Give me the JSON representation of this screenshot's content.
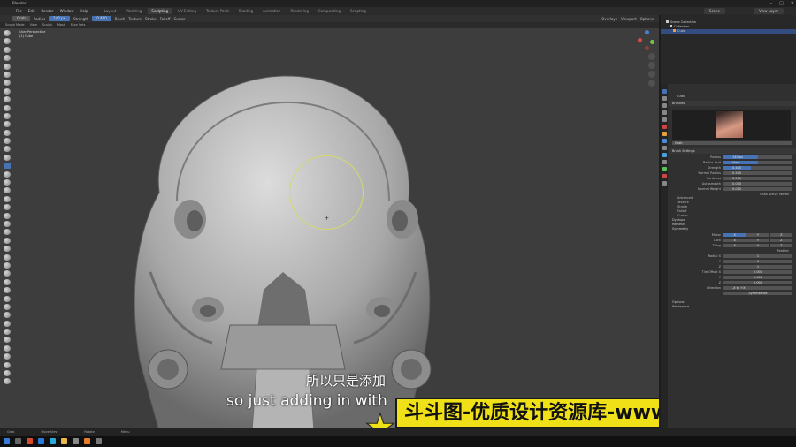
{
  "window": {
    "title": "Blender",
    "controls": [
      "–",
      "□",
      "✕"
    ]
  },
  "menus": [
    "File",
    "Edit",
    "Render",
    "Window",
    "Help"
  ],
  "workspace_tabs": [
    {
      "label": "Layout",
      "active": false
    },
    {
      "label": "Modeling",
      "active": false
    },
    {
      "label": "Sculpting",
      "active": true
    },
    {
      "label": "UV Editing",
      "active": false
    },
    {
      "label": "Texture Paint",
      "active": false
    },
    {
      "label": "Shading",
      "active": false
    },
    {
      "label": "Animation",
      "active": false
    },
    {
      "label": "Rendering",
      "active": false
    },
    {
      "label": "Compositing",
      "active": false
    },
    {
      "label": "Scripting",
      "active": false
    }
  ],
  "scene": {
    "label": "Scene",
    "view_layer": "View Layer"
  },
  "tool_header": {
    "brush_name": "Grab",
    "radius_label": "Radius",
    "radius_value": "140 px",
    "strength_label": "Strength",
    "strength_value": "0.400",
    "menus": [
      "Brush",
      "Texture",
      "Stroke",
      "Falloff",
      "Cursor"
    ],
    "right": [
      "Overlays",
      "Viewport",
      "Options"
    ]
  },
  "mode_header": {
    "mode": "Sculpt Mode",
    "items": [
      "View",
      "Sculpt",
      "Mask",
      "Face Sets"
    ]
  },
  "viewport_info": {
    "line1": "User Perspective",
    "line2": "(1) Cube"
  },
  "subtitles": {
    "chinese": "所以只是添加",
    "english": "so just adding in with"
  },
  "watermark": "斗斗图-优质设计资源库-www.ddotu.com",
  "outliner": {
    "rows": [
      {
        "label": "Scene Collection",
        "selected": false
      },
      {
        "label": "Collection",
        "selected": false
      },
      {
        "label": "Cube",
        "selected": true
      }
    ]
  },
  "properties": {
    "object": "Grab",
    "brushes_label": "Brushes",
    "brush_field": "Grab",
    "brush_settings_label": "Brush Settings",
    "rows": [
      {
        "label": "Radius",
        "value": "140 px",
        "fill": 0.5
      },
      {
        "label": "Radius Unit",
        "value": "View",
        "fill": 0.5
      },
      {
        "label": "Strength",
        "value": "0.400",
        "fill": 0.4
      },
      {
        "label": "Normal Radius",
        "value": "0.500",
        "fill": 0
      },
      {
        "label": "Hardness",
        "value": "0.500",
        "fill": 0
      },
      {
        "label": "Autosmooth",
        "value": "0.000",
        "fill": 0
      },
      {
        "label": "Normal Weight",
        "value": "0.000",
        "fill": 0
      }
    ],
    "use_front_faces": "Grab Active Vertex",
    "subsections": [
      "Advanced",
      "Texture",
      "Stroke",
      "Falloff",
      "Cursor"
    ],
    "dyntopo": "Dyntopo",
    "remesh": "Remesh",
    "symmetry": "Symmetry",
    "symmetry_rows": [
      {
        "label": "Mirror",
        "values": [
          "X",
          "Y",
          "Z"
        ],
        "on": [
          true,
          false,
          false
        ]
      },
      {
        "label": "Lock",
        "values": [
          "X",
          "Y",
          "Z"
        ],
        "on": [
          false,
          false,
          false
        ]
      },
      {
        "label": "Tiling",
        "values": [
          "X",
          "Y",
          "Z"
        ],
        "on": [
          false,
          false,
          false
        ]
      }
    ],
    "feather": "Feather",
    "radial_rows": [
      {
        "label": "Radial X",
        "value": "1"
      },
      {
        "label": "Y",
        "value": "1"
      },
      {
        "label": "Z",
        "value": "1"
      },
      {
        "label": "Tile Offset X",
        "value": "2.000"
      },
      {
        "label": "Y",
        "value": "2.000"
      },
      {
        "label": "Z",
        "value": "2.000"
      }
    ],
    "direction_label": "Direction",
    "direction_value": "-X to +X",
    "symmetrize": "Symmetrize",
    "options": "Options",
    "workspace": "Workspace"
  },
  "status": [
    "Grab",
    "Move View",
    "Rotate",
    "Menu"
  ],
  "colors": {
    "accent": "#4772b3",
    "viewport": "#3d3d3d",
    "brush_circle": "#d6d96a",
    "watermark_bg": "#f0e018"
  }
}
